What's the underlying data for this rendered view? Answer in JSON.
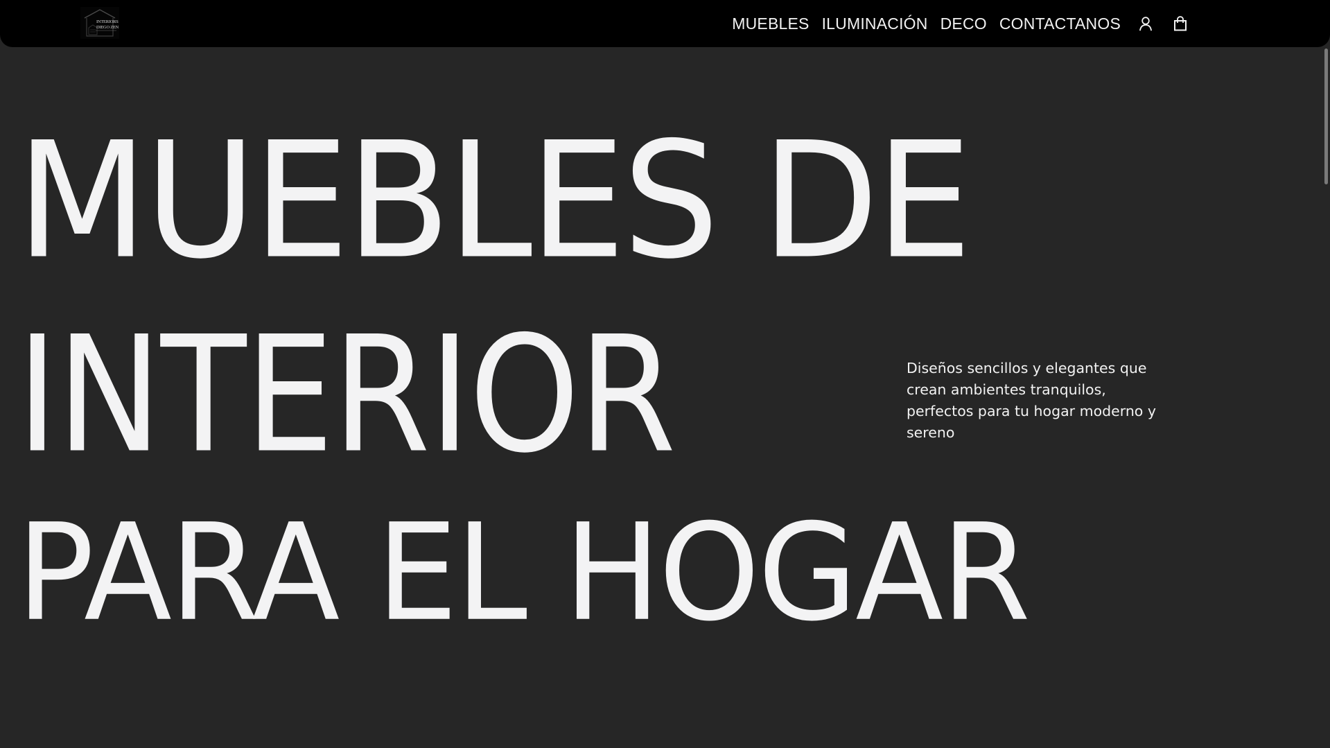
{
  "header": {
    "logo_text": "INTERIORS DIEGO ZEN",
    "nav": {
      "items": [
        {
          "label": "MUEBLES"
        },
        {
          "label": "ILUMINACIÓN"
        },
        {
          "label": "DECO"
        },
        {
          "label": "CONTACTANOS"
        }
      ],
      "user_icon": "user-icon",
      "cart_icon": "shopping-bag-icon"
    }
  },
  "hero": {
    "title_lines": [
      "MUEBLES DE",
      "INTERIOR",
      "PARA EL HOGAR"
    ],
    "description": "Diseños sencillos y elegantes que crean ambientes tranquilos, perfectos para tu hogar moderno y sereno"
  },
  "colors": {
    "navbar_background": "#000000",
    "page_background": "#262626",
    "text": "#f3f3f4"
  }
}
